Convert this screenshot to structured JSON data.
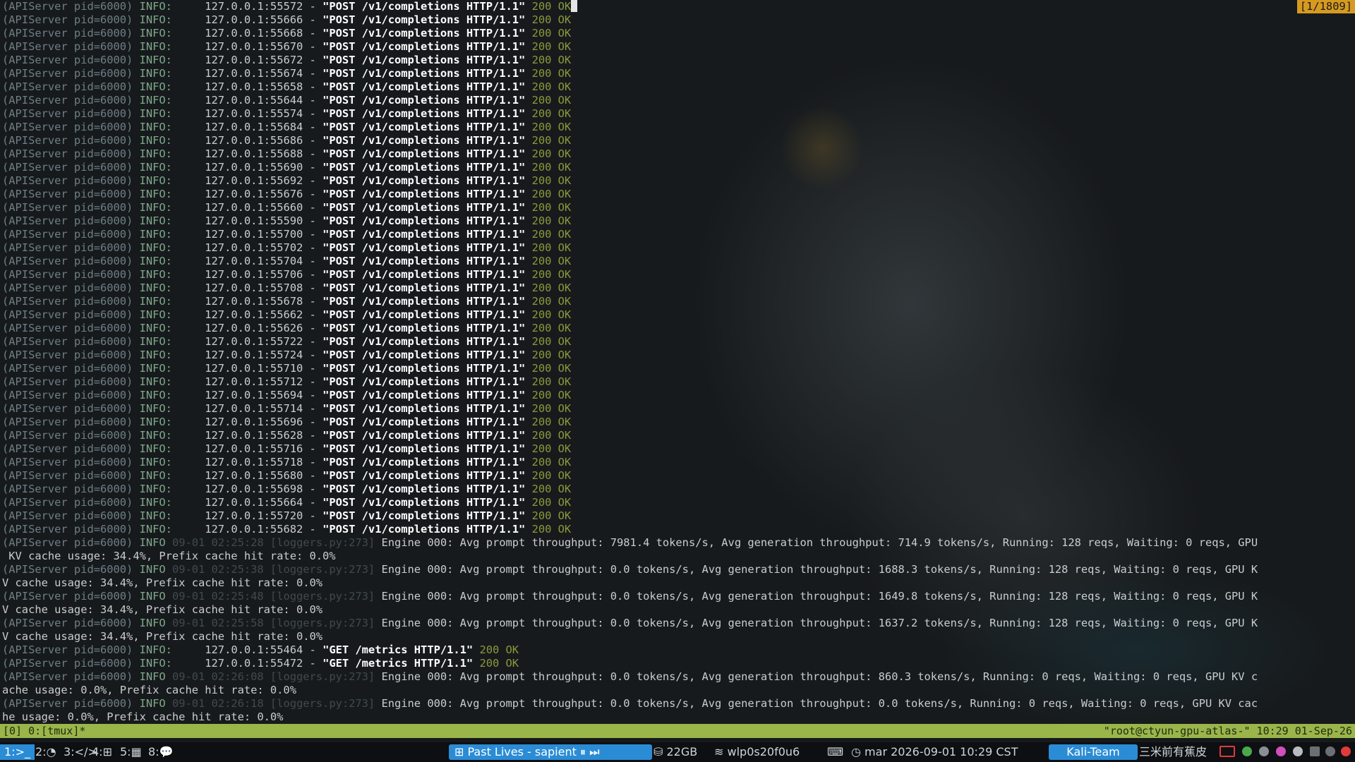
{
  "terminal": {
    "scroll_indicator": "[1/1809]",
    "request_lines": [
      {
        "port": "55572",
        "request": "\"POST /v1/completions HTTP/1.1\"",
        "status": "200 OK"
      },
      {
        "port": "55666",
        "request": "\"POST /v1/completions HTTP/1.1\"",
        "status": "200 OK"
      },
      {
        "port": "55668",
        "request": "\"POST /v1/completions HTTP/1.1\"",
        "status": "200 OK"
      },
      {
        "port": "55670",
        "request": "\"POST /v1/completions HTTP/1.1\"",
        "status": "200 OK"
      },
      {
        "port": "55672",
        "request": "\"POST /v1/completions HTTP/1.1\"",
        "status": "200 OK"
      },
      {
        "port": "55674",
        "request": "\"POST /v1/completions HTTP/1.1\"",
        "status": "200 OK"
      },
      {
        "port": "55658",
        "request": "\"POST /v1/completions HTTP/1.1\"",
        "status": "200 OK"
      },
      {
        "port": "55644",
        "request": "\"POST /v1/completions HTTP/1.1\"",
        "status": "200 OK"
      },
      {
        "port": "55574",
        "request": "\"POST /v1/completions HTTP/1.1\"",
        "status": "200 OK"
      },
      {
        "port": "55684",
        "request": "\"POST /v1/completions HTTP/1.1\"",
        "status": "200 OK"
      },
      {
        "port": "55686",
        "request": "\"POST /v1/completions HTTP/1.1\"",
        "status": "200 OK"
      },
      {
        "port": "55688",
        "request": "\"POST /v1/completions HTTP/1.1\"",
        "status": "200 OK"
      },
      {
        "port": "55690",
        "request": "\"POST /v1/completions HTTP/1.1\"",
        "status": "200 OK"
      },
      {
        "port": "55692",
        "request": "\"POST /v1/completions HTTP/1.1\"",
        "status": "200 OK"
      },
      {
        "port": "55676",
        "request": "\"POST /v1/completions HTTP/1.1\"",
        "status": "200 OK"
      },
      {
        "port": "55660",
        "request": "\"POST /v1/completions HTTP/1.1\"",
        "status": "200 OK"
      },
      {
        "port": "55590",
        "request": "\"POST /v1/completions HTTP/1.1\"",
        "status": "200 OK"
      },
      {
        "port": "55700",
        "request": "\"POST /v1/completions HTTP/1.1\"",
        "status": "200 OK"
      },
      {
        "port": "55702",
        "request": "\"POST /v1/completions HTTP/1.1\"",
        "status": "200 OK"
      },
      {
        "port": "55704",
        "request": "\"POST /v1/completions HTTP/1.1\"",
        "status": "200 OK"
      },
      {
        "port": "55706",
        "request": "\"POST /v1/completions HTTP/1.1\"",
        "status": "200 OK"
      },
      {
        "port": "55708",
        "request": "\"POST /v1/completions HTTP/1.1\"",
        "status": "200 OK"
      },
      {
        "port": "55678",
        "request": "\"POST /v1/completions HTTP/1.1\"",
        "status": "200 OK"
      },
      {
        "port": "55662",
        "request": "\"POST /v1/completions HTTP/1.1\"",
        "status": "200 OK"
      },
      {
        "port": "55626",
        "request": "\"POST /v1/completions HTTP/1.1\"",
        "status": "200 OK"
      },
      {
        "port": "55722",
        "request": "\"POST /v1/completions HTTP/1.1\"",
        "status": "200 OK"
      },
      {
        "port": "55724",
        "request": "\"POST /v1/completions HTTP/1.1\"",
        "status": "200 OK"
      },
      {
        "port": "55710",
        "request": "\"POST /v1/completions HTTP/1.1\"",
        "status": "200 OK"
      },
      {
        "port": "55712",
        "request": "\"POST /v1/completions HTTP/1.1\"",
        "status": "200 OK"
      },
      {
        "port": "55694",
        "request": "\"POST /v1/completions HTTP/1.1\"",
        "status": "200 OK"
      },
      {
        "port": "55714",
        "request": "\"POST /v1/completions HTTP/1.1\"",
        "status": "200 OK"
      },
      {
        "port": "55696",
        "request": "\"POST /v1/completions HTTP/1.1\"",
        "status": "200 OK"
      },
      {
        "port": "55628",
        "request": "\"POST /v1/completions HTTP/1.1\"",
        "status": "200 OK"
      },
      {
        "port": "55716",
        "request": "\"POST /v1/completions HTTP/1.1\"",
        "status": "200 OK"
      },
      {
        "port": "55718",
        "request": "\"POST /v1/completions HTTP/1.1\"",
        "status": "200 OK"
      },
      {
        "port": "55680",
        "request": "\"POST /v1/completions HTTP/1.1\"",
        "status": "200 OK"
      },
      {
        "port": "55698",
        "request": "\"POST /v1/completions HTTP/1.1\"",
        "status": "200 OK"
      },
      {
        "port": "55664",
        "request": "\"POST /v1/completions HTTP/1.1\"",
        "status": "200 OK"
      },
      {
        "port": "55720",
        "request": "\"POST /v1/completions HTTP/1.1\"",
        "status": "200 OK"
      },
      {
        "port": "55682",
        "request": "\"POST /v1/completions HTTP/1.1\"",
        "status": "200 OK"
      }
    ],
    "tail_lines": [
      {
        "kind": "engine",
        "timestamp": "09-01 02:25:28",
        "source": "[loggers.py:273]",
        "message": "Engine 000: Avg prompt throughput: 7981.4 tokens/s, Avg generation throughput: 714.9 tokens/s, Running: 128 reqs, Waiting: 0 reqs, GPU"
      },
      {
        "kind": "wrap",
        "text": " KV cache usage: 34.4%, Prefix cache hit rate: 0.0%"
      },
      {
        "kind": "engine",
        "timestamp": "09-01 02:25:38",
        "source": "[loggers.py:273]",
        "message": "Engine 000: Avg prompt throughput: 0.0 tokens/s, Avg generation throughput: 1688.3 tokens/s, Running: 128 reqs, Waiting: 0 reqs, GPU K"
      },
      {
        "kind": "wrap",
        "text": "V cache usage: 34.4%, Prefix cache hit rate: 0.0%"
      },
      {
        "kind": "engine",
        "timestamp": "09-01 02:25:48",
        "source": "[loggers.py:273]",
        "message": "Engine 000: Avg prompt throughput: 0.0 tokens/s, Avg generation throughput: 1649.8 tokens/s, Running: 128 reqs, Waiting: 0 reqs, GPU K"
      },
      {
        "kind": "wrap",
        "text": "V cache usage: 34.4%, Prefix cache hit rate: 0.0%"
      },
      {
        "kind": "engine",
        "timestamp": "09-01 02:25:58",
        "source": "[loggers.py:273]",
        "message": "Engine 000: Avg prompt throughput: 0.0 tokens/s, Avg generation throughput: 1637.2 tokens/s, Running: 128 reqs, Waiting: 0 reqs, GPU K"
      },
      {
        "kind": "wrap",
        "text": "V cache usage: 34.4%, Prefix cache hit rate: 0.0%"
      },
      {
        "kind": "request",
        "port": "55464",
        "request": "\"GET /metrics HTTP/1.1\"",
        "status": "200 OK"
      },
      {
        "kind": "request",
        "port": "55472",
        "request": "\"GET /metrics HTTP/1.1\"",
        "status": "200 OK"
      },
      {
        "kind": "engine",
        "timestamp": "09-01 02:26:08",
        "source": "[loggers.py:273]",
        "message": "Engine 000: Avg prompt throughput: 0.0 tokens/s, Avg generation throughput: 860.3 tokens/s, Running: 0 reqs, Waiting: 0 reqs, GPU KV c"
      },
      {
        "kind": "wrap",
        "text": "ache usage: 0.0%, Prefix cache hit rate: 0.0%"
      },
      {
        "kind": "engine",
        "timestamp": "09-01 02:26:18",
        "source": "[loggers.py:273]",
        "message": "Engine 000: Avg prompt throughput: 0.0 tokens/s, Avg generation throughput: 0.0 tokens/s, Running: 0 reqs, Waiting: 0 reqs, GPU KV cac"
      },
      {
        "kind": "wrap",
        "text": "he usage: 0.0%, Prefix cache hit rate: 0.0%"
      }
    ],
    "process_prefix": "(APIServer pid=6000)",
    "level": "INFO",
    "host": "127.0.0.1"
  },
  "tmux": {
    "left": "[0] 0:[tmux]*",
    "right": "\"root@ctyun-gpu-atlas-\" 10:29 01-Sep-26"
  },
  "taskbar": {
    "workspaces": [
      {
        "label": "1:",
        "icon": ">_",
        "active": true
      },
      {
        "label": "2:",
        "icon": "◔",
        "active": false
      },
      {
        "label": "3:",
        "icon": "</>",
        "active": false
      },
      {
        "label": "4:",
        "icon": "⊞",
        "active": false
      },
      {
        "label": "5:",
        "icon": "▦",
        "active": false
      },
      {
        "label": "8:",
        "icon": "💬",
        "active": false
      }
    ],
    "now_playing": "Past Lives - sapient",
    "disk": "22GB",
    "network": "wlp0s20f0u6",
    "datetime": "mar 2026-09-01 10:29 CST",
    "team": "Kali-Team",
    "song_cn": "三米前有蕉皮",
    "colors": {
      "accent": "#2b8cd6",
      "tmux_bar": "#9ab54a",
      "scroll_badge": "#d79a21"
    }
  }
}
